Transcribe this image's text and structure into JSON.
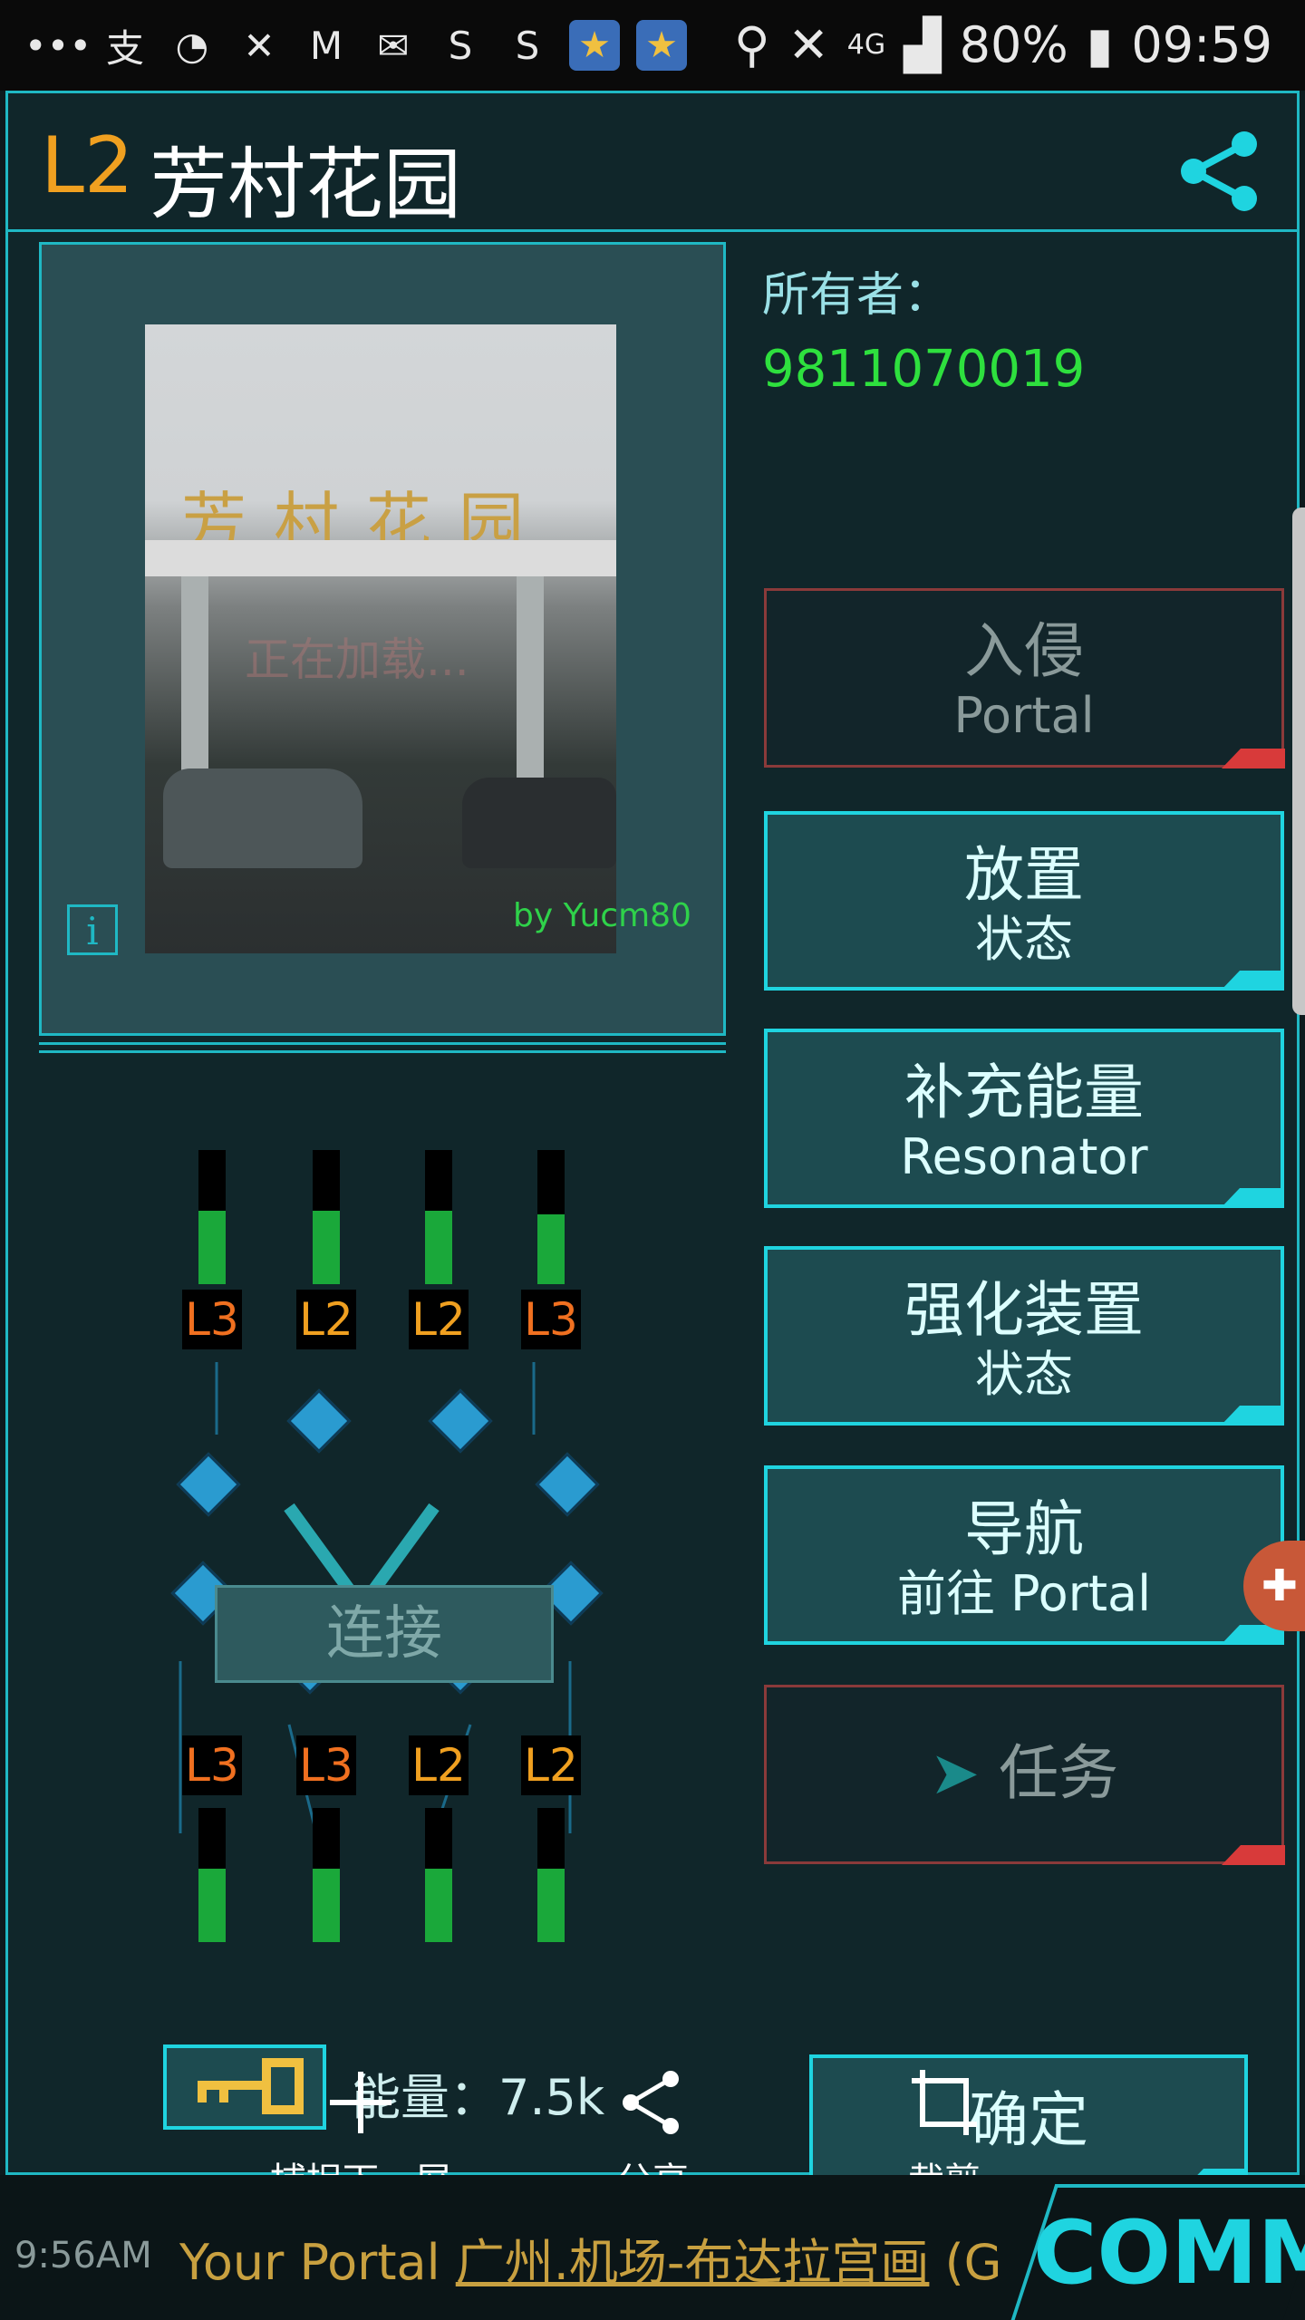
{
  "status_bar": {
    "battery": "80%",
    "time": "09:59",
    "network": "4G",
    "icons": [
      "chat-bubble-icon",
      "alipay-icon",
      "qq-icon",
      "missed-call-icon",
      "gmail-icon",
      "mail-icon",
      "app-s-icon",
      "app-s2-icon",
      "star-badge-icon",
      "star-badge-icon"
    ]
  },
  "portal": {
    "level": "L2",
    "name": "芳村花园",
    "photo_sign": "芳村花园",
    "photo_loading": "正在加载...",
    "photo_credit": "by Yucm80",
    "info_label": "i",
    "owner_label": "所有者：",
    "owner_id": "9811070019"
  },
  "actions": {
    "hack": {
      "title": "入侵",
      "sub": "Portal"
    },
    "deploy": {
      "title": "放置",
      "sub": "状态"
    },
    "recharge": {
      "title": "补充能量",
      "sub": "Resonator"
    },
    "mods": {
      "title": "强化装置",
      "sub": "状态"
    },
    "navigate": {
      "title": "导航",
      "sub": "前往 Portal"
    },
    "mission": {
      "title": "任务"
    },
    "confirm": "确定"
  },
  "resonators": {
    "top_levels": [
      "L3",
      "L2",
      "L2",
      "L3"
    ],
    "bottom_levels": [
      "L3",
      "L3",
      "L2",
      "L2"
    ],
    "top_fill": [
      0.55,
      0.55,
      0.55,
      0.52
    ],
    "bottom_fill": [
      0.55,
      0.55,
      0.55,
      0.55
    ]
  },
  "link_label": "连接",
  "energy_label": "能量：7.5k",
  "capture_toolbar": {
    "capture_more": "捕捉下一屏",
    "share": "分享",
    "crop": "裁剪"
  },
  "comm": {
    "time": "9:56AM",
    "message_prefix": "Your Portal ",
    "message_link": "广州.机场-布达拉宫画",
    "message_suffix": " (G",
    "label": "COMM"
  },
  "colors": {
    "accent": "#1fd4e0",
    "owner_green": "#2ee03e",
    "level_orange": "#f0a020",
    "disabled_red": "#d83a3a"
  }
}
